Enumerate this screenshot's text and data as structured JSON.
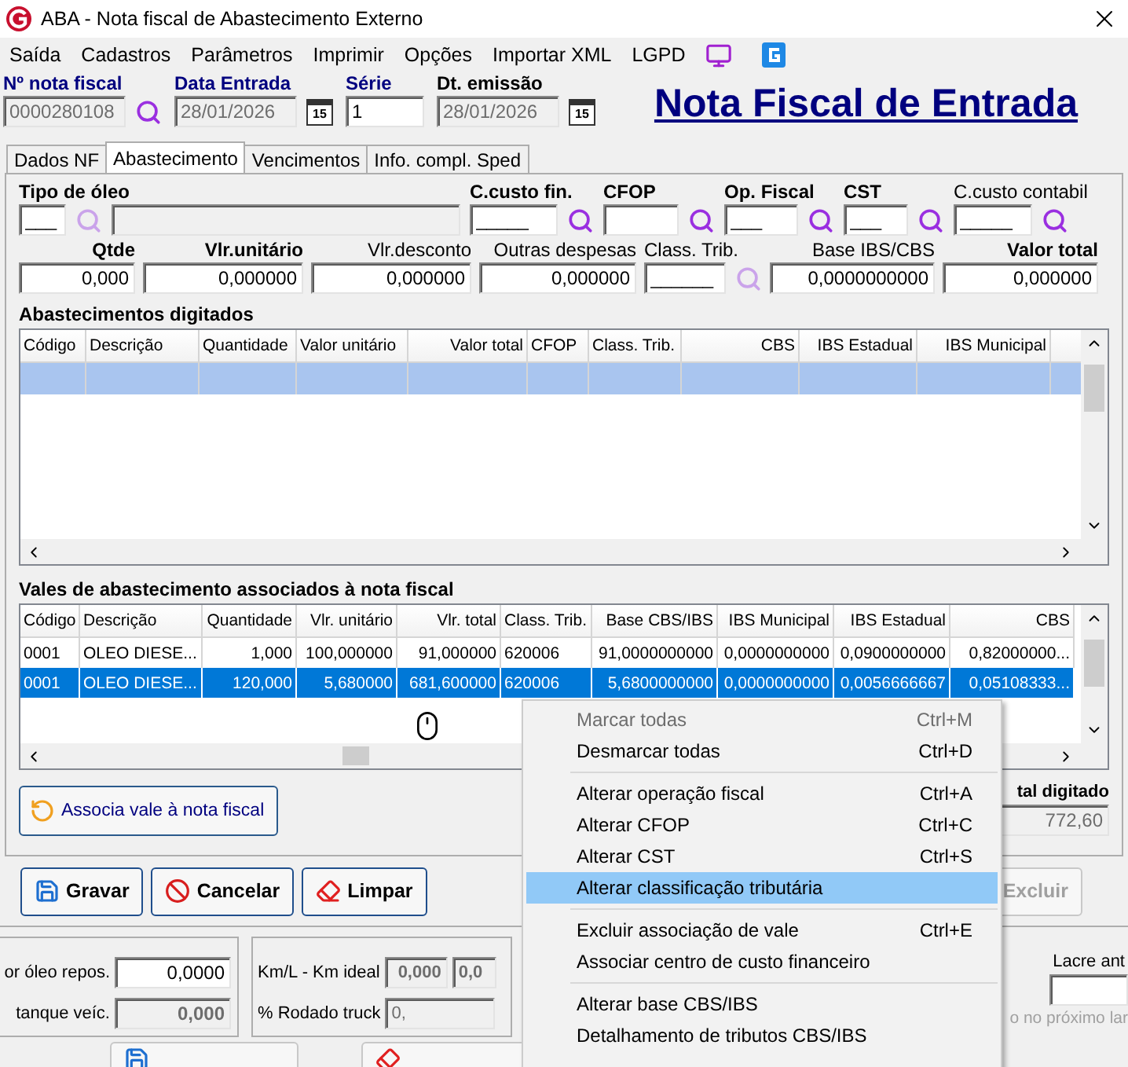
{
  "window": {
    "title": "ABA - Nota fiscal de Abastecimento Externo"
  },
  "menu_bar": [
    {
      "label": "Saída"
    },
    {
      "label": "Cadastros"
    },
    {
      "label": "Parâmetros"
    },
    {
      "label": "Imprimir"
    },
    {
      "label": "Opções"
    },
    {
      "label": "Importar XML"
    },
    {
      "label": "LGPD"
    }
  ],
  "header": {
    "fields": [
      {
        "label": "Nº nota fiscal",
        "value": "0000280108",
        "kind": "search",
        "required": true
      },
      {
        "label": "Data Entrada",
        "value": "28/01/2026",
        "kind": "date",
        "required": true,
        "calendar_day": "15"
      },
      {
        "label": "Série",
        "value": "1",
        "kind": "plain",
        "required": true
      },
      {
        "label": "Dt. emissão",
        "value": "28/01/2026",
        "kind": "date",
        "required": false,
        "calendar_day": "15"
      }
    ],
    "heading": "Nota Fiscal de Entrada"
  },
  "tabs": [
    {
      "label": "Dados NF",
      "selected": false
    },
    {
      "label": "Abastecimento",
      "selected": true
    },
    {
      "label": "Vencimentos",
      "selected": false
    },
    {
      "label": "Info. compl. Sped",
      "selected": false
    }
  ],
  "fuel_form": {
    "row_1": [
      {
        "label": "Tipo de óleo",
        "value": "___",
        "required": true,
        "kind": "with_description",
        "search_disabled": true
      },
      {
        "label": "C.custo fin.",
        "value": "_____",
        "required": true,
        "kind": "lookup",
        "search_disabled": false
      },
      {
        "label": "CFOP",
        "required": true,
        "kind": "lookup",
        "search_disabled": false
      },
      {
        "label": "Op. Fiscal",
        "value": "___",
        "required": true,
        "kind": "lookup",
        "search_disabled": false
      },
      {
        "label": "CST",
        "value": "___",
        "required": true,
        "kind": "lookup",
        "search_disabled": false
      },
      {
        "label": "C.custo contabil",
        "value": "_____",
        "required": false,
        "kind": "lookup",
        "search_disabled": false
      }
    ],
    "row_2": [
      {
        "label": "Qtde",
        "value": "0,000",
        "required": true,
        "kind": "number"
      },
      {
        "label": "Vlr.unitário",
        "value": "0,000000",
        "required": true,
        "kind": "number"
      },
      {
        "label": "Vlr.desconto",
        "value": "0,000000",
        "required": false,
        "kind": "number"
      },
      {
        "label": "Outras despesas",
        "value": "0,000000",
        "required": false,
        "kind": "number"
      },
      {
        "label": "Class. Trib.",
        "value": "______",
        "required": false,
        "kind": "lookup",
        "search_disabled": true
      },
      {
        "label": "Base IBS/CBS",
        "value": "0,0000000000",
        "required": false,
        "kind": "number"
      },
      {
        "label": "Valor total",
        "value": "0,000000",
        "required": true,
        "kind": "number"
      }
    ]
  },
  "fuel_table": {
    "title": "Abastecimentos digitados",
    "columns": [
      "Código",
      "Descrição",
      "Quantidade",
      "Valor unitário",
      "Valor total",
      "CFOP",
      "Class. Trib.",
      "CBS",
      "IBS Estadual",
      "IBS Municipal"
    ],
    "rows": [
      {
        "selected": true
      }
    ]
  },
  "vouchers_table": {
    "title": "Vales de abastecimento associados à nota fiscal",
    "columns": [
      "Código",
      "Descrição",
      "Quantidade",
      "Vlr. unitário",
      "Vlr. total",
      "Class. Trib.",
      "Base CBS/IBS",
      "IBS Municipal",
      "IBS Estadual",
      "CBS"
    ],
    "rows": [
      {
        "selected": false,
        "cells": [
          "0001",
          "OLEO DIESE...",
          "1,000",
          "100,000000",
          "91,000000",
          "620006",
          "91,0000000000",
          "0,0000000000",
          "0,0900000000",
          "0,82000000..."
        ]
      },
      {
        "selected": true,
        "cells": [
          "0001",
          "OLEO DIESE...",
          "120,000",
          "5,680000",
          "681,600000",
          "620006",
          "5,6800000000",
          "0,0000000000",
          "0,0056666667",
          "0,05108333..."
        ]
      }
    ]
  },
  "associate_button": "Associa vale à nota fiscal",
  "total": {
    "label": "tal digitado",
    "value": "772,60"
  },
  "actions": [
    {
      "label": "Gravar",
      "kind": "save",
      "disabled": false
    },
    {
      "label": "Cancelar",
      "kind": "cancel",
      "disabled": false
    },
    {
      "label": "Limpar",
      "kind": "clear",
      "disabled": false
    },
    {
      "label": "Excluir",
      "kind": "delete",
      "disabled": true
    }
  ],
  "lower_panel": {
    "left": [
      {
        "label": "or óleo repos.",
        "value": "0,0000",
        "disabled": false
      },
      {
        "label": "tanque veíc.",
        "value": "0,000",
        "disabled": true
      }
    ],
    "middle": [
      {
        "label": "Km/L - Km ideal",
        "values": [
          "0,000",
          "0,0"
        ]
      },
      {
        "label": "% Rodado truck",
        "values": [
          "0,"
        ]
      }
    ],
    "lacre_label": "Lacre ant",
    "note": "o no próximo lar"
  },
  "context_menu": [
    {
      "kind": "item",
      "label": "Marcar todas",
      "shortcut": "Ctrl+M",
      "disabled": true,
      "selected": false
    },
    {
      "kind": "item",
      "label": "Desmarcar todas",
      "shortcut": "Ctrl+D",
      "disabled": false,
      "selected": false
    },
    {
      "kind": "separator"
    },
    {
      "kind": "item",
      "label": "Alterar operação fiscal",
      "shortcut": "Ctrl+A",
      "disabled": false,
      "selected": false
    },
    {
      "kind": "item",
      "label": "Alterar CFOP",
      "shortcut": "Ctrl+C",
      "disabled": false,
      "selected": false
    },
    {
      "kind": "item",
      "label": "Alterar CST",
      "shortcut": "Ctrl+S",
      "disabled": false,
      "selected": false
    },
    {
      "kind": "item",
      "label": "Alterar classificação tributária",
      "disabled": false,
      "selected": true
    },
    {
      "kind": "separator"
    },
    {
      "kind": "item",
      "label": "Excluir associação de vale",
      "shortcut": "Ctrl+E",
      "disabled": false,
      "selected": false
    },
    {
      "kind": "item",
      "label": "Associar centro de custo financeiro",
      "disabled": false,
      "selected": false
    },
    {
      "kind": "separator"
    },
    {
      "kind": "item",
      "label": "Alterar base CBS/IBS",
      "disabled": false,
      "selected": false
    },
    {
      "kind": "item",
      "label": "Detalhamento de tributos CBS/IBS",
      "disabled": false,
      "selected": false
    }
  ]
}
